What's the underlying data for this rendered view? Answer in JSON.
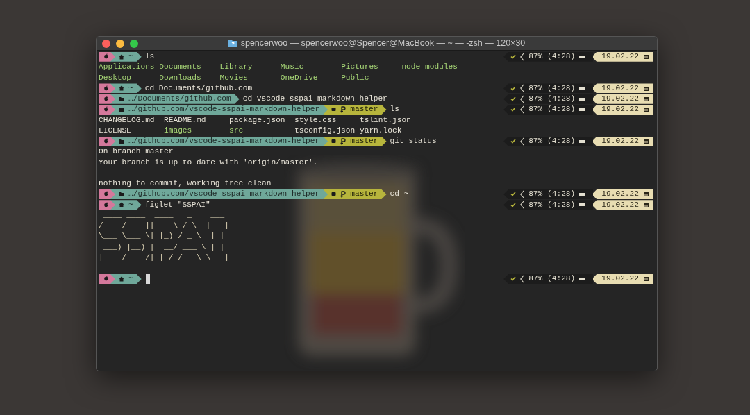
{
  "window": {
    "title": "spencerwoo — spencerwoo@Spencer@MacBook — ~ — -zsh — 120×30"
  },
  "lines": [
    {
      "kind": "prompt",
      "location": {
        "kind": "home",
        "text": "~"
      },
      "command": "ls",
      "status": {
        "battery": "87% (4:28)",
        "date": "19.02.22"
      }
    },
    {
      "kind": "listing",
      "rows": [
        [
          {
            "text": "Applications",
            "kind": "directory"
          },
          {
            "text": "Documents",
            "kind": "directory"
          },
          {
            "text": "Library",
            "kind": "directory"
          },
          {
            "text": "Music",
            "kind": "directory"
          },
          {
            "text": "Pictures",
            "kind": "directory"
          },
          {
            "text": "node_modules",
            "kind": "directory"
          }
        ],
        [
          {
            "text": "Desktop",
            "kind": "directory"
          },
          {
            "text": "Downloads",
            "kind": "directory"
          },
          {
            "text": "Movies",
            "kind": "directory"
          },
          {
            "text": "OneDrive",
            "kind": "directory"
          },
          {
            "text": "Public",
            "kind": "directory"
          }
        ]
      ]
    },
    {
      "kind": "prompt",
      "location": {
        "kind": "home",
        "text": "~"
      },
      "command": "cd Documents/github.com",
      "status": {
        "battery": "87% (4:28)",
        "date": "19.02.22"
      }
    },
    {
      "kind": "prompt",
      "location": {
        "kind": "folder",
        "text": "…/Documents/github.com"
      },
      "command": "cd vscode-sspai-markdown-helper",
      "status": {
        "battery": "87% (4:28)",
        "date": "19.02.22"
      }
    },
    {
      "kind": "prompt",
      "location": {
        "kind": "folder",
        "text": "…/github.com/vscode-sspai-markdown-helper"
      },
      "branch": "master",
      "command": "ls",
      "status": {
        "battery": "87% (4:28)",
        "date": "19.02.22"
      }
    },
    {
      "kind": "listing",
      "rows": [
        [
          {
            "text": "CHANGELOG.md",
            "kind": "file"
          },
          {
            "text": "README.md",
            "kind": "file"
          },
          {
            "text": "package.json",
            "kind": "file"
          },
          {
            "text": "style.css",
            "kind": "file"
          },
          {
            "text": "tslint.json",
            "kind": "file"
          }
        ],
        [
          {
            "text": "LICENSE",
            "kind": "file"
          },
          {
            "text": "images",
            "kind": "directory"
          },
          {
            "text": "src",
            "kind": "directory"
          },
          {
            "text": "tsconfig.json",
            "kind": "file"
          },
          {
            "text": "yarn.lock",
            "kind": "file"
          }
        ]
      ]
    },
    {
      "kind": "prompt",
      "location": {
        "kind": "folder",
        "text": "…/github.com/vscode-sspai-markdown-helper"
      },
      "branch": "master",
      "command": "git status",
      "status": {
        "battery": "87% (4:28)",
        "date": "19.02.22"
      }
    },
    {
      "kind": "output",
      "text": "On branch master"
    },
    {
      "kind": "output",
      "text": "Your branch is up to date with 'origin/master'."
    },
    {
      "kind": "blank"
    },
    {
      "kind": "output",
      "text": "nothing to commit, working tree clean"
    },
    {
      "kind": "prompt",
      "location": {
        "kind": "folder",
        "text": "…/github.com/vscode-sspai-markdown-helper"
      },
      "branch": "master",
      "command": "cd ~",
      "status": {
        "battery": "87% (4:28)",
        "date": "19.02.22"
      }
    },
    {
      "kind": "prompt",
      "location": {
        "kind": "home",
        "text": "~"
      },
      "command": "figlet \"SSPAI\"",
      "status": {
        "battery": "87% (4:28)",
        "date": "19.02.22"
      }
    },
    {
      "kind": "ascii",
      "lines": [
        " ____ ____  ____   _    ___",
        "/ ___/ ___||  _ \\ / \\  |_ _|",
        "\\___ \\___ \\| |_) / _ \\  | |",
        " ___) |__) |  __/ ___ \\ | |",
        "|____/____/|_| /_/   \\_\\___|"
      ]
    },
    {
      "kind": "blank"
    },
    {
      "kind": "prompt",
      "location": {
        "kind": "home",
        "text": "~"
      },
      "cursor": true,
      "status": {
        "battery": "87% (4:28)",
        "date": "19.02.22"
      }
    }
  ]
}
